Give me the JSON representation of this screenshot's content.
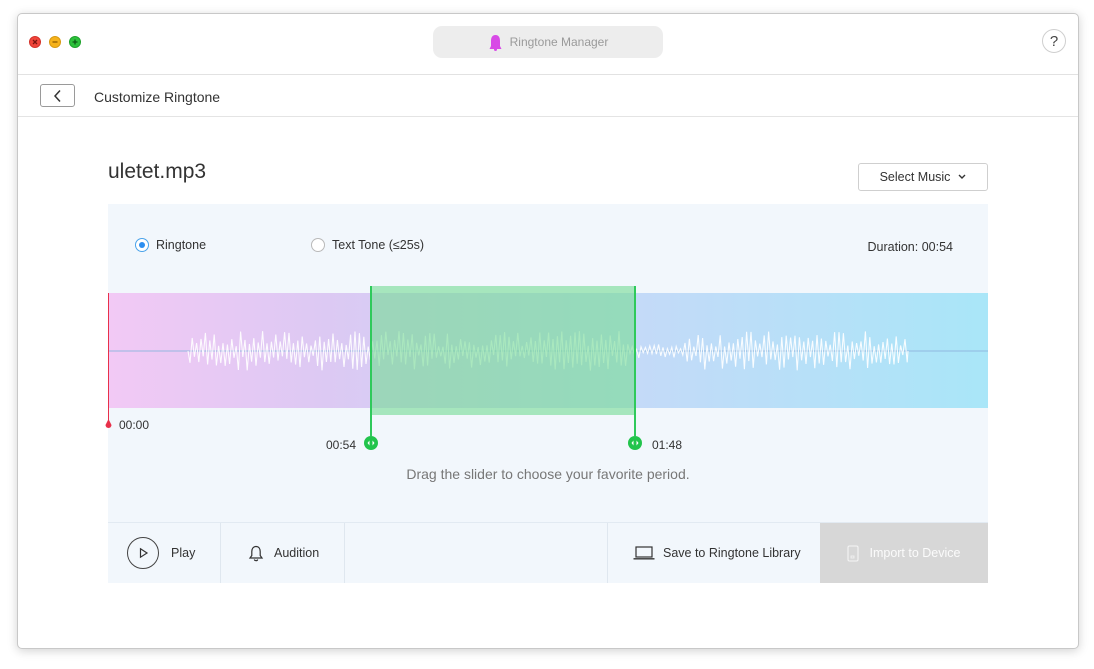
{
  "window": {
    "title": "Ringtone Manager",
    "help_label": "?"
  },
  "header": {
    "page_title": "Customize Ringtone"
  },
  "main": {
    "file_name": "uletet.mp3",
    "select_music_label": "Select Music",
    "modes": [
      {
        "label": "Ringtone",
        "selected": true
      },
      {
        "label": "Text Tone (≤25s)",
        "selected": false
      }
    ],
    "duration": "Duration: 00:54",
    "playhead_time": "00:00",
    "selection_start": "00:54",
    "selection_end": "01:48",
    "hint": "Drag the slider to choose your favorite period."
  },
  "toolbar": {
    "play_label": "Play",
    "audition_label": "Audition",
    "save_label": "Save to Ringtone Library",
    "import_label": "Import to Device"
  },
  "colors": {
    "accent": "#2b8ef0",
    "selection": "#22c44c",
    "playhead": "#e8304a",
    "disabled_button": "#d7d7d7"
  }
}
